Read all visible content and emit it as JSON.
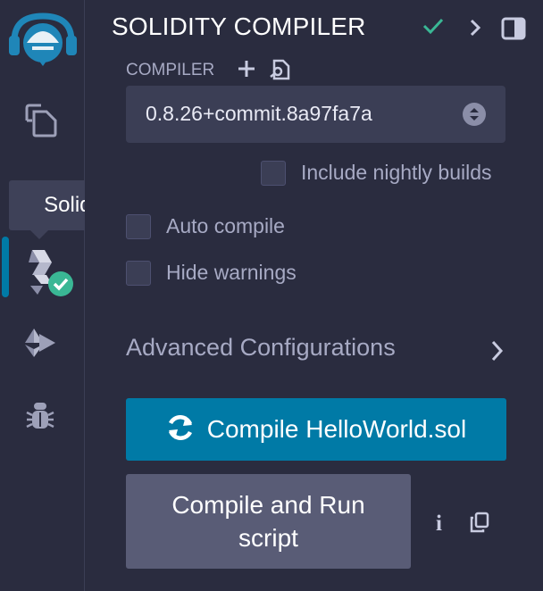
{
  "sidebar": {
    "items": [
      {
        "name": "logo"
      },
      {
        "name": "file-explorer"
      },
      {
        "name": "search"
      },
      {
        "name": "solidity-compiler",
        "active": true
      },
      {
        "name": "deploy-run"
      },
      {
        "name": "debugger"
      }
    ],
    "tooltip": "Solidity compiler"
  },
  "header": {
    "title": "SOLIDITY COMPILER"
  },
  "compiler": {
    "section_label": "COMPILER",
    "version": "0.8.26+commit.8a97fa7a",
    "include_nightly_label": "Include nightly builds",
    "auto_compile_label": "Auto compile",
    "hide_warnings_label": "Hide warnings"
  },
  "advanced": {
    "label": "Advanced Configurations"
  },
  "actions": {
    "compile_label": "Compile HelloWorld.sol",
    "run_label": "Compile and Run script"
  },
  "colors": {
    "accent": "#007aa6",
    "success": "#3ab795",
    "bg": "#2a2c3f"
  }
}
